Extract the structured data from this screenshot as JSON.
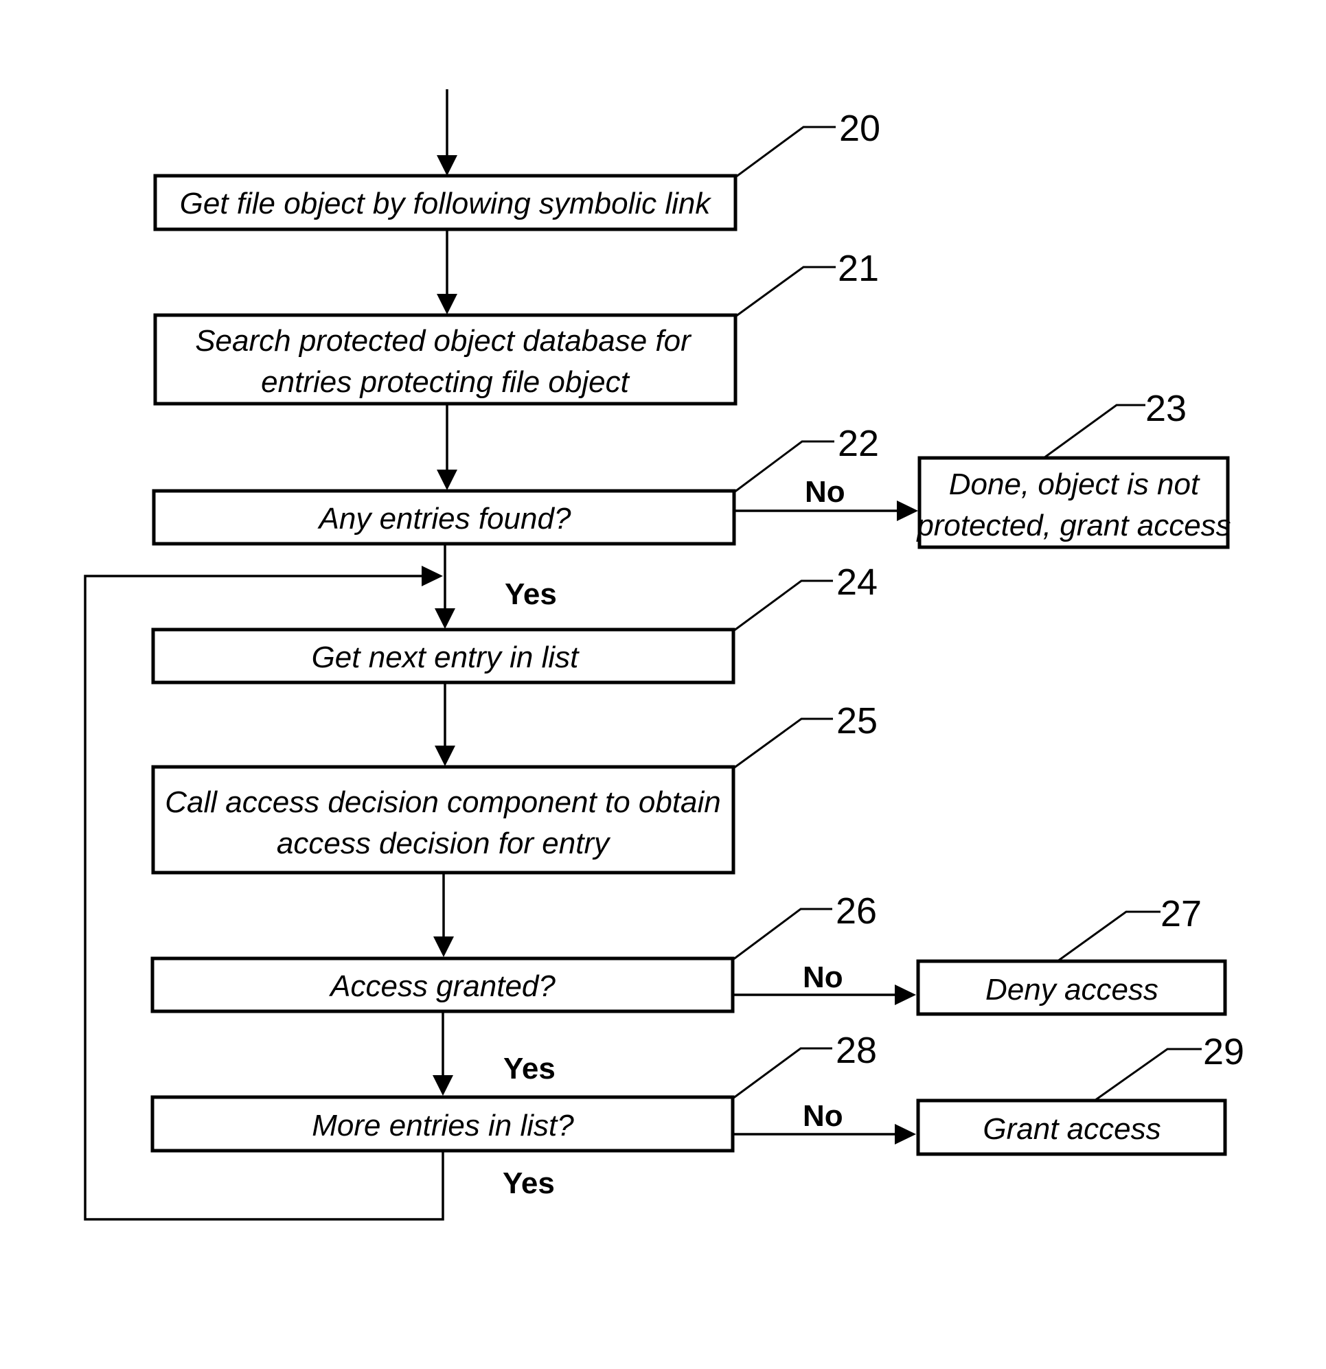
{
  "figure": {
    "steps": [
      {
        "ref": "20",
        "lines": [
          "Get file object by following symbolic link"
        ]
      },
      {
        "ref": "21",
        "lines": [
          "Search protected object database for",
          "entries protecting file object"
        ]
      },
      {
        "ref": "22",
        "lines": [
          "Any entries found?"
        ]
      },
      {
        "ref": "23",
        "lines": [
          "Done, object is not",
          "protected, grant access"
        ]
      },
      {
        "ref": "24",
        "lines": [
          "Get next entry in list"
        ]
      },
      {
        "ref": "25",
        "lines": [
          "Call access decision component to obtain",
          "access decision for entry"
        ]
      },
      {
        "ref": "26",
        "lines": [
          "Access granted?"
        ]
      },
      {
        "ref": "27",
        "lines": [
          "Deny access"
        ]
      },
      {
        "ref": "28",
        "lines": [
          "More entries in list?"
        ]
      },
      {
        "ref": "29",
        "lines": [
          "Grant access"
        ]
      }
    ],
    "edge_labels": {
      "no_22": "No",
      "yes_22": "Yes",
      "no_26": "No",
      "yes_26": "Yes",
      "no_28": "No",
      "yes_28": "Yes"
    }
  }
}
